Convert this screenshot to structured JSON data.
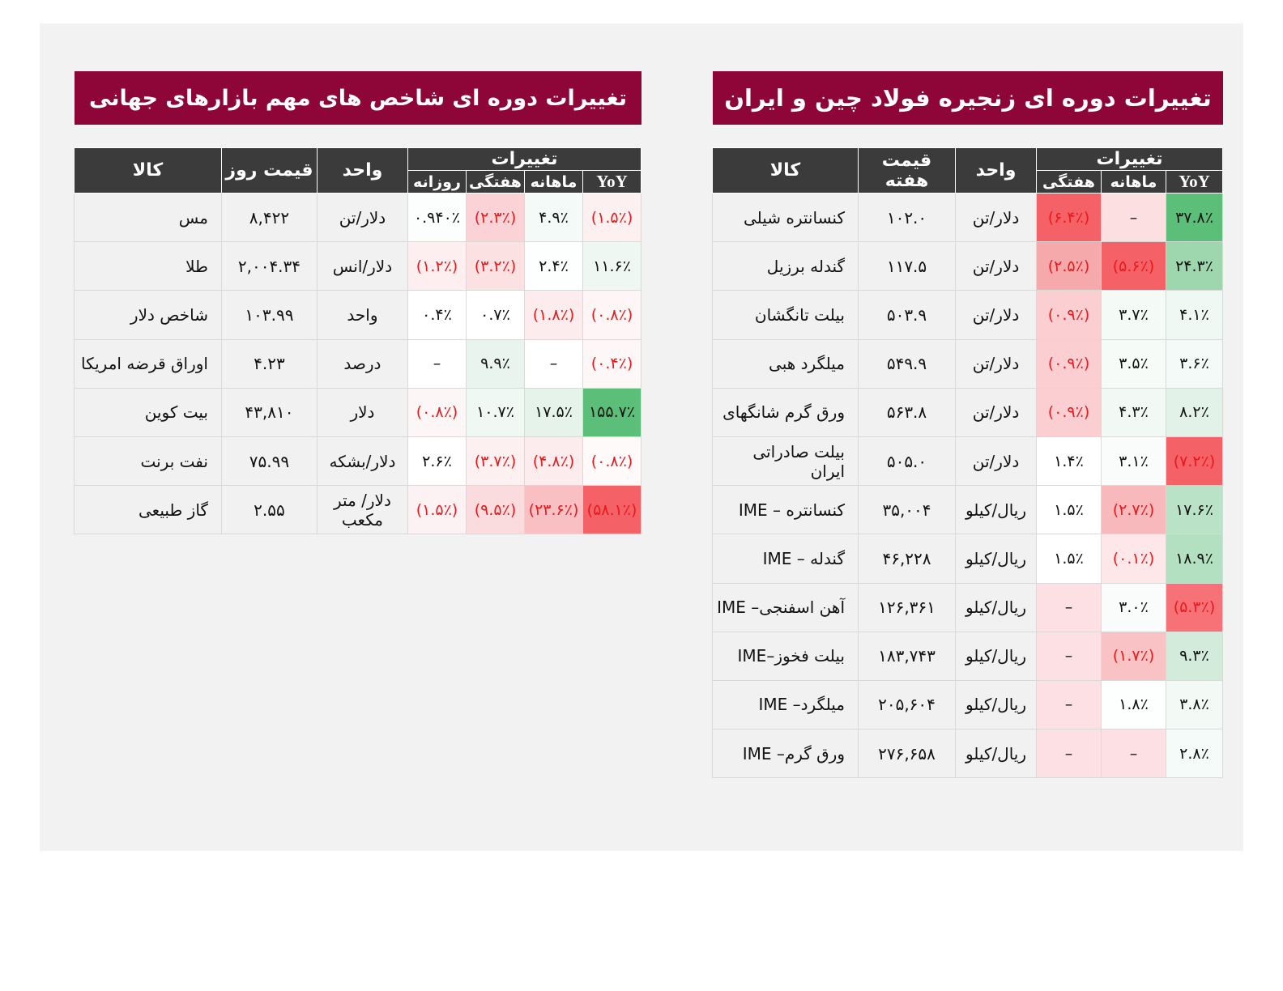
{
  "colors": {
    "title_bar": "#8e0538",
    "table_header": "#3b3b3b",
    "negative_text": "#e8191c",
    "strong_green": "#5bbe79",
    "strong_red": "#f46167"
  },
  "right_panel": {
    "title": "تغییرات دوره ای زنجیره فولاد چین و ایران",
    "headers": {
      "changes_group": "تغییرات",
      "yoy": "YoY",
      "monthly": "ماهانه",
      "weekly": "هفتگی",
      "unit": "واحد",
      "price": "قیمت هفته",
      "commodity": "کالا"
    },
    "rows": [
      {
        "name": "کنسانتره  شیلی",
        "price": "۱۰۲.۰",
        "unit": "دلار/تن",
        "weekly": "(۶.۴٪)",
        "weekly_bg": "#f46167",
        "weekly_neg": true,
        "monthly": "–",
        "monthly_bg": "#fbdfe1",
        "monthly_neg": false,
        "yoy": "۳۷.۸٪",
        "yoy_bg": "#5bbe79",
        "yoy_neg": false
      },
      {
        "name": "گندله برزیل",
        "price": "۱۱۷.۵",
        "unit": "دلار/تن",
        "weekly": "(۲.۵٪)",
        "weekly_bg": "#f5a9ab",
        "weekly_neg": true,
        "monthly": "(۵.۶٪)",
        "monthly_bg": "#f46167",
        "monthly_neg": true,
        "yoy": "۲۴.۳٪",
        "yoy_bg": "#9ed6ae",
        "yoy_neg": false
      },
      {
        "name": "بیلت تانگشان",
        "price": "۵۰۳.۹",
        "unit": "دلار/تن",
        "weekly": "(۰.۹٪)",
        "weekly_bg": "#fbcfd2",
        "weekly_neg": true,
        "monthly": "۳.۷٪",
        "monthly_bg": "#f4faf6",
        "monthly_neg": false,
        "yoy": "۴.۱٪",
        "yoy_bg": "#f0f8f3",
        "yoy_neg": false
      },
      {
        "name": "میلگرد هبی",
        "price": "۵۴۹.۹",
        "unit": "دلار/تن",
        "weekly": "(۰.۹٪)",
        "weekly_bg": "#fbcfd2",
        "weekly_neg": true,
        "monthly": "۳.۵٪",
        "monthly_bg": "#f6fbf8",
        "monthly_neg": false,
        "yoy": "۳.۶٪",
        "yoy_bg": "#f4faf7",
        "yoy_neg": false
      },
      {
        "name": "ورق گرم شانگهای",
        "price": "۵۶۳.۸",
        "unit": "دلار/تن",
        "weekly": "(۰.۹٪)",
        "weekly_bg": "#fbcfd2",
        "weekly_neg": true,
        "monthly": "۴.۳٪",
        "monthly_bg": "#f2f9f5",
        "monthly_neg": false,
        "yoy": "۸.۲٪",
        "yoy_bg": "#e2f2e8",
        "yoy_neg": false
      },
      {
        "name": "بیلت صادراتی ایران",
        "price": "۵۰۵.۰",
        "unit": "دلار/تن",
        "weekly": "۱.۴٪",
        "weekly_bg": "#ffffff",
        "weekly_neg": false,
        "monthly": "۳.۱٪",
        "monthly_bg": "#fafcfb",
        "monthly_neg": false,
        "yoy": "(۷.۲٪)",
        "yoy_bg": "#f46167",
        "yoy_neg": true
      },
      {
        "name": "کنسانتره – IME",
        "price": "۳۵,۰۰۴",
        "unit": "ریال/کیلو",
        "weekly": "۱.۵٪",
        "weekly_bg": "#ffffff",
        "weekly_neg": false,
        "monthly": "(۲.۷٪)",
        "monthly_bg": "#f8b9bc",
        "monthly_neg": true,
        "yoy": "۱۷.۶٪",
        "yoy_bg": "#b9e2c6",
        "yoy_neg": false
      },
      {
        "name": "گندله – IME",
        "price": "۴۶,۲۲۸",
        "unit": "ریال/کیلو",
        "weekly": "۱.۵٪",
        "weekly_bg": "#ffffff",
        "weekly_neg": false,
        "monthly": "(۰.۱٪)",
        "monthly_bg": "#fde7e9",
        "monthly_neg": true,
        "yoy": "۱۸.۹٪",
        "yoy_bg": "#b4e0c2",
        "yoy_neg": false
      },
      {
        "name": "آهن اسفنجی– IME",
        "price": "۱۲۶,۳۶۱",
        "unit": "ریال/کیلو",
        "weekly": "–",
        "weekly_bg": "#fce0e3",
        "weekly_neg": false,
        "monthly": "۳.۰٪",
        "monthly_bg": "#fafcfb",
        "monthly_neg": false,
        "yoy": "(۵.۳٪)",
        "yoy_bg": "#f67277",
        "yoy_neg": true
      },
      {
        "name": "بیلت فخوز–IME",
        "price": "۱۸۳,۷۴۳",
        "unit": "ریال/کیلو",
        "weekly": "–",
        "weekly_bg": "#fce0e3",
        "weekly_neg": false,
        "monthly": "(۱.۷٪)",
        "monthly_bg": "#f9c3c6",
        "monthly_neg": true,
        "yoy": "۹.۳٪",
        "yoy_bg": "#d2ebda",
        "yoy_neg": false
      },
      {
        "name": "میلگرد– IME",
        "price": "۲۰۵,۶۰۴",
        "unit": "ریال/کیلو",
        "weekly": "–",
        "weekly_bg": "#fce0e3",
        "weekly_neg": false,
        "monthly": "۱.۸٪",
        "monthly_bg": "#fdfefe",
        "monthly_neg": false,
        "yoy": "۳.۸٪",
        "yoy_bg": "#f3faf6",
        "yoy_neg": false
      },
      {
        "name": "ورق گرم– IME",
        "price": "۲۷۶,۶۵۸",
        "unit": "ریال/کیلو",
        "weekly": "–",
        "weekly_bg": "#fce0e3",
        "weekly_neg": false,
        "monthly": "–",
        "monthly_bg": "#fce0e3",
        "monthly_neg": false,
        "yoy": "۲.۸٪",
        "yoy_bg": "#f5fbf8",
        "yoy_neg": false
      }
    ]
  },
  "left_panel": {
    "title": "تغییرات دوره ای شاخص های مهم بازارهای جهانی",
    "headers": {
      "changes_group": "تغییرات",
      "yoy": "YoY",
      "monthly": "ماهانه",
      "weekly": "هفتگی",
      "daily": "روزانه",
      "unit": "واحد",
      "price": "قیمت روز",
      "commodity": "کالا"
    },
    "rows": [
      {
        "name": "مس",
        "price": "۸,۴۲۲",
        "unit": "دلار/تن",
        "daily": "۰.۹۴۰٪",
        "daily_bg": "#fcfefd",
        "daily_neg": false,
        "weekly": "(۲.۳٪)",
        "weekly_bg": "#fbd2d5",
        "weekly_neg": true,
        "monthly": "۴.۹٪",
        "monthly_bg": "#f4faf7",
        "monthly_neg": false,
        "yoy": "(۱.۵٪)",
        "yoy_bg": "#fdf0f1",
        "yoy_neg": true
      },
      {
        "name": "طلا",
        "price": "۲,۰۰۴.۳۴",
        "unit": "دلار/انس",
        "daily": "(۱.۲٪)",
        "daily_bg": "#fdeff0",
        "daily_neg": true,
        "weekly": "(۳.۲٪)",
        "weekly_bg": "#fce1e3",
        "weekly_neg": true,
        "monthly": "۲.۴٪",
        "monthly_bg": "#fdfefe",
        "monthly_neg": false,
        "yoy": "۱۱.۶٪",
        "yoy_bg": "#eef7f2",
        "yoy_neg": false
      },
      {
        "name": "شاخص دلار",
        "price": "۱۰۳.۹۹",
        "unit": "واحد",
        "daily": "۰.۴٪",
        "daily_bg": "#ffffff",
        "daily_neg": false,
        "weekly": "۰.۷٪",
        "weekly_bg": "#ffffff",
        "weekly_neg": false,
        "monthly": "(۱.۸٪)",
        "monthly_bg": "#fdeced",
        "monthly_neg": true,
        "yoy": "(۰.۸٪)",
        "yoy_bg": "#fdf5f6",
        "yoy_neg": true
      },
      {
        "name": "اوراق قرضه امریکا",
        "price": "۴.۲۳",
        "unit": "درصد",
        "daily": "–",
        "daily_bg": "#ffffff",
        "daily_neg": false,
        "weekly": "۹.۹٪",
        "weekly_bg": "#eaf4ee",
        "weekly_neg": false,
        "monthly": "–",
        "monthly_bg": "#ffffff",
        "monthly_neg": false,
        "yoy": "(۰.۴٪)",
        "yoy_bg": "#fdf7f8",
        "yoy_neg": true
      },
      {
        "name": "بیت کوین",
        "price": "۴۳,۸۱۰",
        "unit": "دلار",
        "daily": "(۰.۸٪)",
        "daily_bg": "#fdf6f7",
        "daily_neg": true,
        "weekly": "۱۰.۷٪",
        "weekly_bg": "#f0f8f3",
        "weekly_neg": false,
        "monthly": "۱۷.۵٪",
        "monthly_bg": "#e6f3eb",
        "monthly_neg": false,
        "yoy": "۱۵۵.۷٪",
        "yoy_bg": "#5bbe79",
        "yoy_neg": false
      },
      {
        "name": "نفت برنت",
        "price": "۷۵.۹۹",
        "unit": "دلار/بشکه",
        "daily": "۲.۶٪",
        "daily_bg": "#ffffff",
        "daily_neg": false,
        "weekly": "(۳.۷٪)",
        "weekly_bg": "#fdf0f1",
        "weekly_neg": true,
        "monthly": "(۴.۸٪)",
        "monthly_bg": "#fdeced",
        "monthly_neg": true,
        "yoy": "(۰.۸٪)",
        "yoy_bg": "#fefafa",
        "yoy_neg": true
      },
      {
        "name": "گاز طبیعی",
        "price": "۲.۵۵",
        "unit": "دلار/ متر مکعب",
        "daily": "(۱.۵٪)",
        "daily_bg": "#fdf2f3",
        "daily_neg": true,
        "weekly": "(۹.۵٪)",
        "weekly_bg": "#fbdcde",
        "weekly_neg": true,
        "monthly": "(۲۳.۶٪)",
        "monthly_bg": "#f9c0c3",
        "monthly_neg": true,
        "yoy": "(۵۸.۱٪)",
        "yoy_bg": "#f46167",
        "yoy_neg": true
      }
    ]
  }
}
